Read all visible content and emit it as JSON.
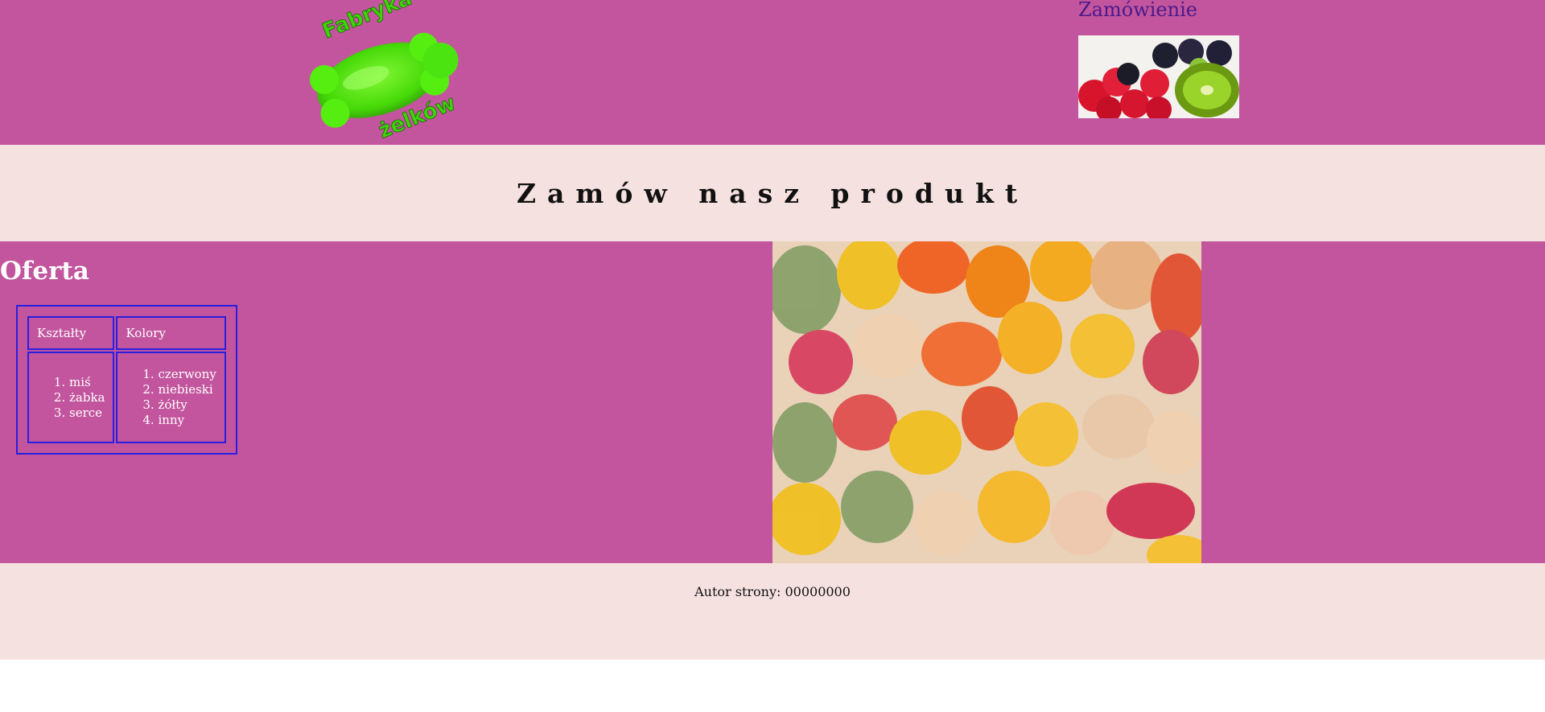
{
  "header": {
    "logo_text_top": "Fabryka",
    "logo_text_bottom": "żelków",
    "order_link": "Zamówienie"
  },
  "banner": {
    "title": "Zamów nasz produkt"
  },
  "offer": {
    "title": "Oferta",
    "columns": [
      "Kształty",
      "Kolory"
    ],
    "shapes": [
      "miś",
      "żabka",
      "serce"
    ],
    "colors": [
      "czerwony",
      "niebieski",
      "żółty",
      "inny"
    ]
  },
  "footer": {
    "author": "Autor strony: 00000000"
  },
  "colors": {
    "header_bg": "#c2559d",
    "band_bg": "#f5e2e0",
    "table_border": "#2a1fe0",
    "link": "#4b1a8c",
    "logo_green": "#4cf214"
  }
}
